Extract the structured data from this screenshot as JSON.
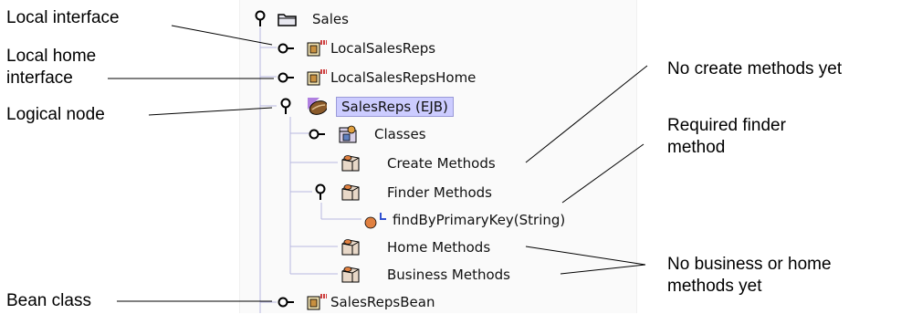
{
  "tree": {
    "root": {
      "label": "Sales",
      "icon": "folder-icon"
    },
    "nodes": [
      {
        "label": "LocalSalesReps",
        "icon": "interface-icon"
      },
      {
        "label": "LocalSalesRepsHome",
        "icon": "interface-icon"
      },
      {
        "label": "SalesReps (EJB)",
        "icon": "bean-icon",
        "selected": true
      },
      {
        "label": "Classes",
        "icon": "classes-icon"
      },
      {
        "label": "Create Methods",
        "icon": "method-group-icon"
      },
      {
        "label": "Finder Methods",
        "icon": "method-group-icon"
      },
      {
        "label": "findByPrimaryKey(String)",
        "icon": "method-icon"
      },
      {
        "label": "Home Methods",
        "icon": "method-group-icon"
      },
      {
        "label": "Business Methods",
        "icon": "method-group-icon"
      },
      {
        "label": "SalesRepsBean",
        "icon": "interface-icon"
      }
    ]
  },
  "callouts": {
    "local_interface": "Local interface",
    "local_home_interface_1": "Local home",
    "local_home_interface_2": "interface",
    "logical_node": "Logical node",
    "bean_class": "Bean class",
    "no_create": "No create methods yet",
    "required_finder_1": "Required finder",
    "required_finder_2": "method",
    "no_business_1": "No business or home",
    "no_business_2": "methods yet"
  },
  "colors": {
    "selection": "#ccccff",
    "tree_line": "#b8b8e0",
    "bean": "#8a5a2a",
    "method_dot": "#e08040"
  }
}
